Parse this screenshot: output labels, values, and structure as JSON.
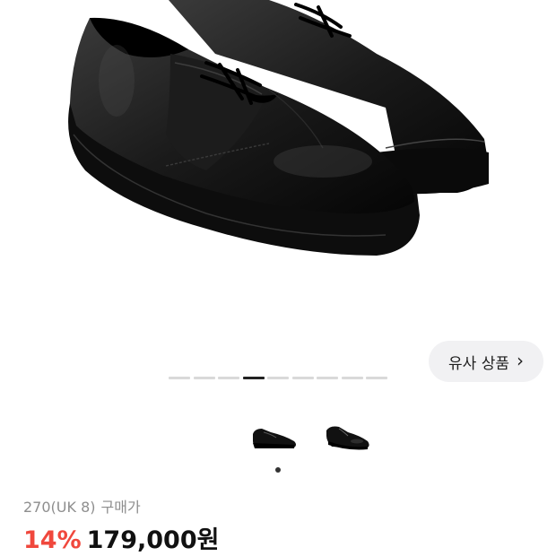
{
  "product": {
    "image_icon": "shoe-image",
    "pager": {
      "total": 9,
      "active": 4
    },
    "similar_button": {
      "label": "유사 상품",
      "icon": "chevron-right-icon"
    },
    "thumbnails": [
      "shoe-side-thumbnail",
      "shoe-angle-thumbnail"
    ],
    "size": {
      "value": "270(UK 8)",
      "label": "구매가"
    },
    "discount": "14%",
    "price": "179,000원"
  },
  "colors": {
    "discount": "#f0483d",
    "muted_text": "#8e8e8e",
    "button_bg": "#f1f1f3"
  }
}
